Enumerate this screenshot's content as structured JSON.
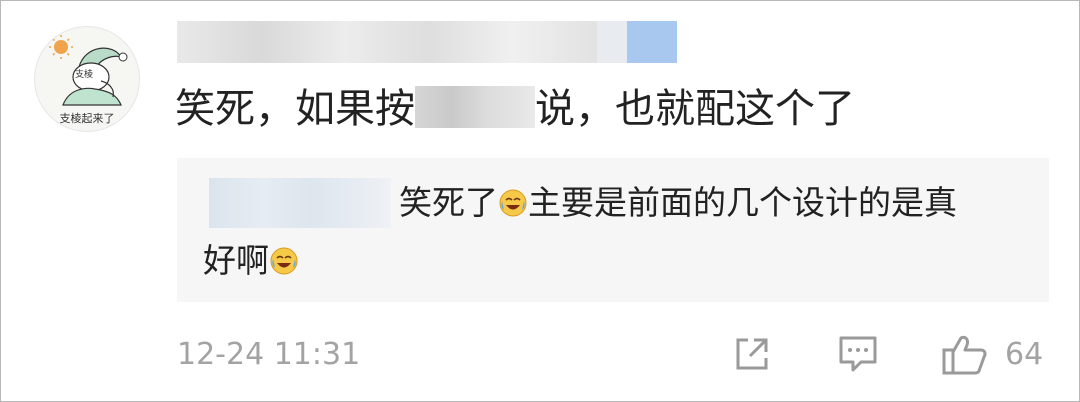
{
  "avatar": {
    "caption": "支棱起来了",
    "badge": "支棱"
  },
  "comment": {
    "text_before": "笑死，如果按",
    "text_after": "说，也就配这个了"
  },
  "reply": {
    "text_line1": "笑死了",
    "text_line1_rest": "主要是前面的几个设计的是真",
    "text_line2": "好啊",
    "emoji": "laugh-cry-emoji"
  },
  "footer": {
    "timestamp": "12-24 11:31",
    "like_count": "64",
    "icons": [
      "share-icon",
      "comment-icon",
      "like-icon"
    ]
  },
  "colors": {
    "text": "#222222",
    "muted": "#a3a3a3",
    "reply_bg": "#f6f6f6"
  }
}
